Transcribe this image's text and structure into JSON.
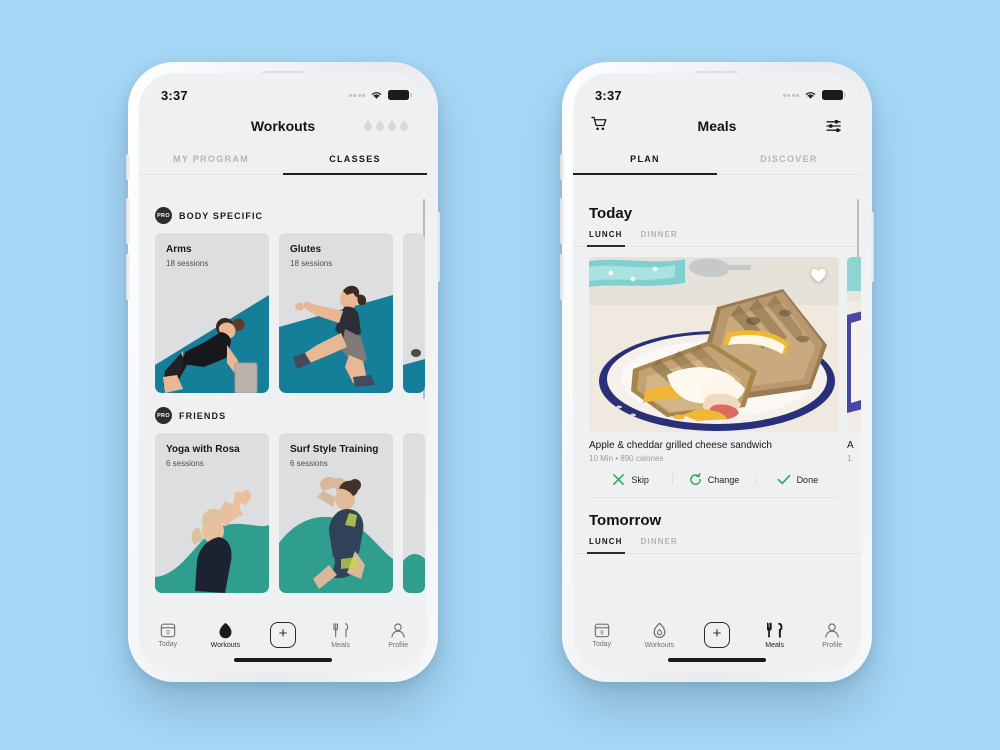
{
  "background_color": "#a6d8f7",
  "accent_teal": "#157e99",
  "accent_green": "#2f9e8f",
  "action_green": "#27ae60",
  "left_phone": {
    "status": {
      "time": "3:37",
      "signal_icon": "signal-dots-icon",
      "wifi_icon": "wifi-icon",
      "battery_icon": "battery-icon"
    },
    "header": {
      "title": "Workouts",
      "streak_icon": "flame-outline-icon",
      "streak_count": 4
    },
    "tabs": [
      {
        "label": "MY PROGRAM",
        "active": false
      },
      {
        "label": "CLASSES",
        "active": true
      }
    ],
    "sections": [
      {
        "badge": "PRO",
        "title": "BODY SPECIFIC",
        "cards": [
          {
            "name": "Arms",
            "sessions": "18 sessions"
          },
          {
            "name": "Glutes",
            "sessions": "18 sessions"
          },
          {
            "name": "",
            "sessions": ""
          }
        ]
      },
      {
        "badge": "PRO",
        "title": "FRIENDS",
        "cards": [
          {
            "name": "Yoga with Rosa",
            "sessions": "6 sessions"
          },
          {
            "name": "Surf Style Training",
            "sessions": "6 sessions"
          },
          {
            "name": "",
            "sessions": ""
          }
        ]
      }
    ],
    "tabbar": [
      {
        "label": "Today",
        "icon": "calendar-icon",
        "badge": "8",
        "active": false
      },
      {
        "label": "Workouts",
        "icon": "flame-icon",
        "active": true
      },
      {
        "label": "",
        "icon": "plus-icon",
        "active": false
      },
      {
        "label": "Meals",
        "icon": "cutlery-icon",
        "active": false
      },
      {
        "label": "Profile",
        "icon": "person-icon",
        "active": false
      }
    ]
  },
  "right_phone": {
    "status": {
      "time": "3:37",
      "signal_icon": "signal-dots-icon",
      "wifi_icon": "wifi-icon",
      "battery_icon": "battery-icon"
    },
    "header": {
      "title": "Meals",
      "left_icon": "shopping-cart-icon",
      "right_icon": "sliders-filter-icon"
    },
    "tabs": [
      {
        "label": "PLAN",
        "active": true
      },
      {
        "label": "DISCOVER",
        "active": false
      }
    ],
    "today": {
      "title": "Today",
      "meal_tabs": [
        {
          "label": "LUNCH",
          "active": true
        },
        {
          "label": "DINNER",
          "active": false
        }
      ],
      "meal": {
        "name": "Apple & cheddar grilled cheese sandwich",
        "meta": "10 Min • 890 calories",
        "favorite_icon": "heart-icon",
        "actions": [
          {
            "label": "Skip",
            "icon": "x-icon"
          },
          {
            "label": "Change",
            "icon": "refresh-icon"
          },
          {
            "label": "Done",
            "icon": "check-icon"
          }
        ]
      },
      "next_meal_partial": {
        "name": "A",
        "meta": "1"
      }
    },
    "tomorrow": {
      "title": "Tomorrow",
      "meal_tabs": [
        {
          "label": "LUNCH",
          "active": true
        },
        {
          "label": "DINNER",
          "active": false
        }
      ]
    },
    "tabbar": [
      {
        "label": "Today",
        "icon": "calendar-icon",
        "badge": "8",
        "active": false
      },
      {
        "label": "Workouts",
        "icon": "flame-icon",
        "active": false
      },
      {
        "label": "",
        "icon": "plus-icon",
        "active": false
      },
      {
        "label": "Meals",
        "icon": "cutlery-icon",
        "active": true
      },
      {
        "label": "Profile",
        "icon": "person-icon",
        "active": false
      }
    ]
  }
}
